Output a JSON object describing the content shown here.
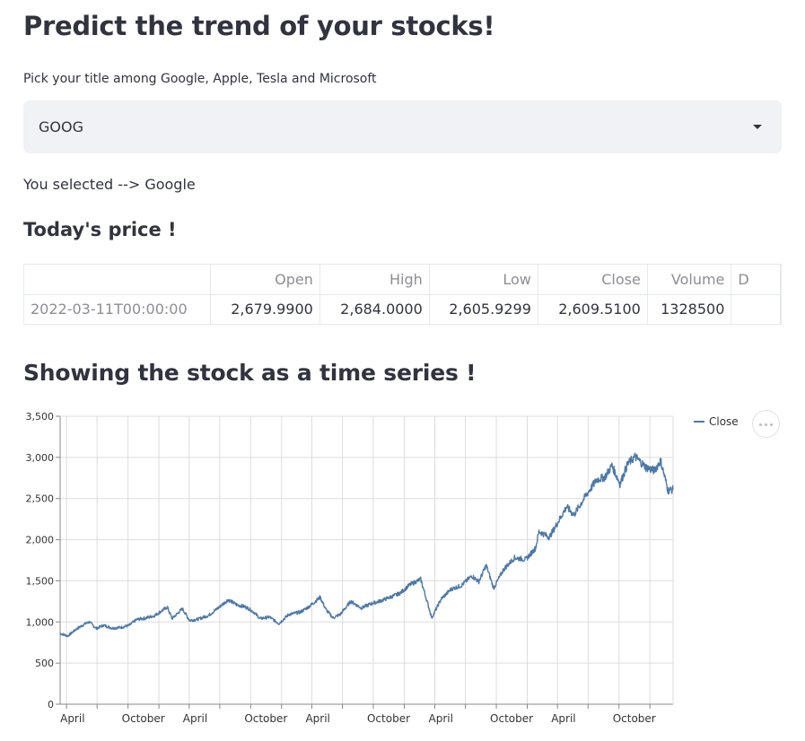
{
  "page": {
    "title": "Predict the trend of your stocks!"
  },
  "selector": {
    "label": "Pick your title among Google, Apple, Tesla and Microsoft",
    "value": "GOOG",
    "selected_text": "You selected --> Google"
  },
  "price_section": {
    "title": "Today's price !",
    "columns": [
      "",
      "Open",
      "High",
      "Low",
      "Close",
      "Volume",
      "D"
    ],
    "rows": [
      [
        "2022-03-11T00:00:00",
        "2,679.9900",
        "2,684.0000",
        "2,605.9299",
        "2,609.5100",
        "1328500",
        ""
      ]
    ]
  },
  "timeseries_section": {
    "title": "Showing the stock as a time series !"
  },
  "chart_data": {
    "type": "line",
    "x_range": [
      "2017-03-13",
      "2022-03-11"
    ],
    "ylim": [
      0,
      3500
    ],
    "y_ticks": [
      "0",
      "500",
      "1,000",
      "1,500",
      "2,000",
      "2,500",
      "3,000",
      "3,500"
    ],
    "x_ticks": [
      {
        "date": "2017-04-01",
        "label": "April"
      },
      {
        "date": "2017-10-01",
        "label": "October"
      },
      {
        "date": "2018-04-01",
        "label": "April"
      },
      {
        "date": "2018-10-01",
        "label": "October"
      },
      {
        "date": "2019-04-01",
        "label": "April"
      },
      {
        "date": "2019-10-01",
        "label": "October"
      },
      {
        "date": "2020-04-01",
        "label": "April"
      },
      {
        "date": "2020-10-01",
        "label": "October"
      },
      {
        "date": "2021-04-01",
        "label": "April"
      },
      {
        "date": "2021-10-01",
        "label": "October"
      }
    ],
    "grid": true,
    "legend": "top-right",
    "color": "#4c78a8",
    "series": [
      {
        "name": "Close",
        "points": [
          [
            "2017-03-13",
            860
          ],
          [
            "2017-04-05",
            830
          ],
          [
            "2017-05-01",
            915
          ],
          [
            "2017-05-25",
            975
          ],
          [
            "2017-06-08",
            1000
          ],
          [
            "2017-06-29",
            920
          ],
          [
            "2017-07-20",
            960
          ],
          [
            "2017-08-15",
            925
          ],
          [
            "2017-09-12",
            935
          ],
          [
            "2017-10-05",
            960
          ],
          [
            "2017-10-27",
            1030
          ],
          [
            "2017-11-20",
            1045
          ],
          [
            "2017-12-18",
            1075
          ],
          [
            "2018-01-26",
            1180
          ],
          [
            "2018-02-09",
            1040
          ],
          [
            "2018-03-12",
            1160
          ],
          [
            "2018-04-02",
            1020
          ],
          [
            "2018-04-25",
            1030
          ],
          [
            "2018-05-29",
            1080
          ],
          [
            "2018-06-20",
            1150
          ],
          [
            "2018-07-26",
            1270
          ],
          [
            "2018-08-20",
            1210
          ],
          [
            "2018-09-18",
            1180
          ],
          [
            "2018-10-10",
            1120
          ],
          [
            "2018-10-29",
            1040
          ],
          [
            "2018-11-26",
            1060
          ],
          [
            "2018-12-24",
            980
          ],
          [
            "2019-01-22",
            1090
          ],
          [
            "2019-02-26",
            1120
          ],
          [
            "2019-03-25",
            1190
          ],
          [
            "2019-04-26",
            1300
          ],
          [
            "2019-05-13",
            1150
          ],
          [
            "2019-06-03",
            1050
          ],
          [
            "2019-06-24",
            1090
          ],
          [
            "2019-07-26",
            1250
          ],
          [
            "2019-08-26",
            1170
          ],
          [
            "2019-09-24",
            1220
          ],
          [
            "2019-10-25",
            1260
          ],
          [
            "2019-11-20",
            1300
          ],
          [
            "2019-12-20",
            1350
          ],
          [
            "2020-01-17",
            1450
          ],
          [
            "2020-02-19",
            1520
          ],
          [
            "2020-03-23",
            1050
          ],
          [
            "2020-04-20",
            1280
          ],
          [
            "2020-05-20",
            1400
          ],
          [
            "2020-06-18",
            1440
          ],
          [
            "2020-07-20",
            1560
          ],
          [
            "2020-08-10",
            1490
          ],
          [
            "2020-09-01",
            1690
          ],
          [
            "2020-09-23",
            1410
          ],
          [
            "2020-10-23",
            1640
          ],
          [
            "2020-11-24",
            1780
          ],
          [
            "2020-12-28",
            1760
          ],
          [
            "2021-01-26",
            1900
          ],
          [
            "2021-02-05",
            2100
          ],
          [
            "2021-03-08",
            2030
          ],
          [
            "2021-04-09",
            2260
          ],
          [
            "2021-04-28",
            2400
          ],
          [
            "2021-05-20",
            2300
          ],
          [
            "2021-06-25",
            2540
          ],
          [
            "2021-07-27",
            2730
          ],
          [
            "2021-08-20",
            2760
          ],
          [
            "2021-09-10",
            2900
          ],
          [
            "2021-10-04",
            2680
          ],
          [
            "2021-10-27",
            2920
          ],
          [
            "2021-11-18",
            3010
          ],
          [
            "2021-12-20",
            2880
          ],
          [
            "2022-01-14",
            2840
          ],
          [
            "2022-02-02",
            2960
          ],
          [
            "2022-02-24",
            2600
          ],
          [
            "2022-03-11",
            2609
          ]
        ]
      }
    ]
  }
}
